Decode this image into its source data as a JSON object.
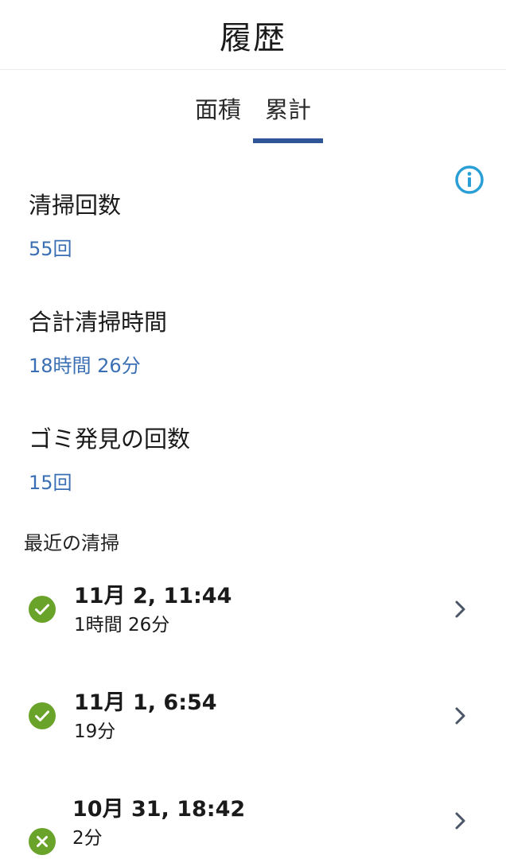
{
  "header": {
    "title": "履歴"
  },
  "tabs": [
    {
      "label": "面積",
      "active": false
    },
    {
      "label": "累計",
      "active": true
    }
  ],
  "info_icon": "info-icon",
  "stats": [
    {
      "label": "清掃回数",
      "value": "55回"
    },
    {
      "label": "合計清掃時間",
      "value": "18時間 26分"
    },
    {
      "label": "ゴミ発見の回数",
      "value": "15回"
    }
  ],
  "recent": {
    "title": "最近の清掃",
    "items": [
      {
        "date": "11月 2, 11:44",
        "duration": "1時間 26分",
        "status": "success",
        "icon": "check-circle-icon"
      },
      {
        "date": "11月 1, 6:54",
        "duration": "19分",
        "status": "success",
        "icon": "check-circle-icon"
      },
      {
        "date": "10月 31, 18:42",
        "duration": "2分",
        "status": "failed",
        "icon": "x-circle-icon"
      }
    ]
  },
  "colors": {
    "accent": "#2e5596",
    "value_text": "#3b6fb3",
    "info": "#2a9fd6",
    "success": "#6aa32a",
    "chevron": "#4a5568"
  }
}
